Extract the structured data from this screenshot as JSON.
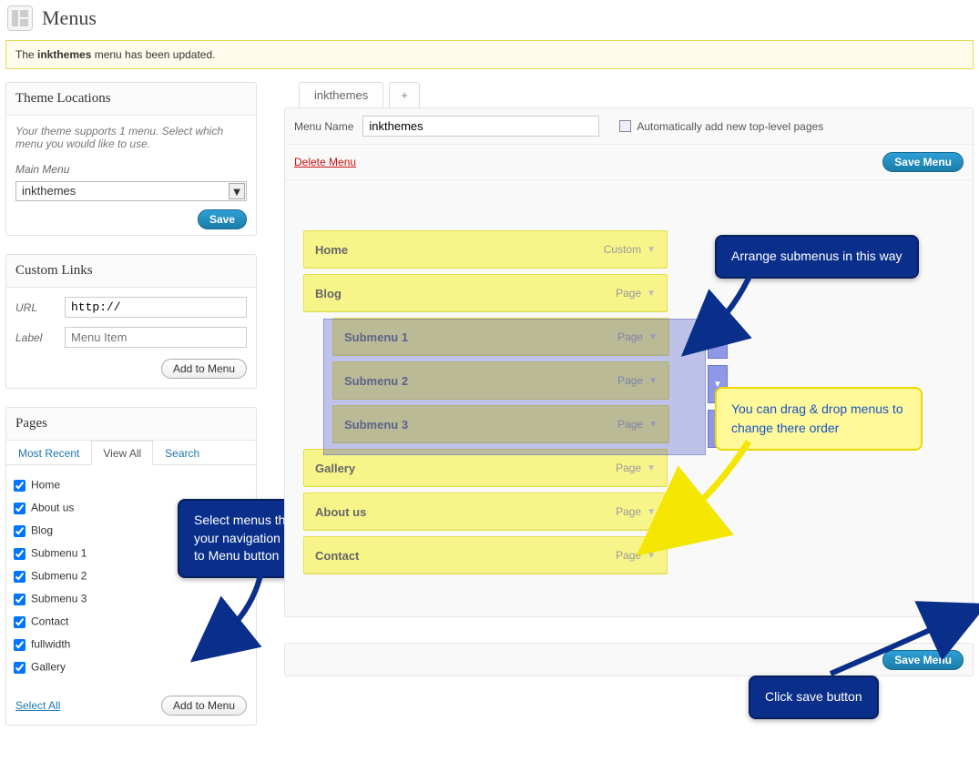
{
  "page": {
    "title": "Menus",
    "notice_prefix": "The ",
    "notice_strong": "inkthemes",
    "notice_suffix": " menu has been updated."
  },
  "sidebar": {
    "theme_locations": {
      "title": "Theme Locations",
      "desc": "Your theme supports 1 menu. Select which menu you would like to use.",
      "main_menu_label": "Main Menu",
      "select_value": "inkthemes",
      "save_label": "Save"
    },
    "custom_links": {
      "title": "Custom Links",
      "url_label": "URL",
      "url_value": "http://",
      "label_label": "Label",
      "label_placeholder": "Menu Item",
      "add_label": "Add to Menu"
    },
    "pages": {
      "title": "Pages",
      "tabs": [
        "Most Recent",
        "View All",
        "Search"
      ],
      "active_tab": "View All",
      "items": [
        {
          "label": "Home",
          "checked": true,
          "indent": 0
        },
        {
          "label": "About us",
          "checked": true,
          "indent": 0
        },
        {
          "label": "Blog",
          "checked": true,
          "indent": 0
        },
        {
          "label": "Submenu 1",
          "checked": true,
          "indent": 1
        },
        {
          "label": "Submenu 2",
          "checked": true,
          "indent": 1
        },
        {
          "label": "Submenu 3",
          "checked": true,
          "indent": 1
        },
        {
          "label": "Contact",
          "checked": true,
          "indent": 0
        },
        {
          "label": "fullwidth",
          "checked": true,
          "indent": 0
        },
        {
          "label": "Gallery",
          "checked": true,
          "indent": 0
        }
      ],
      "select_all": "Select All",
      "add_label": "Add to Menu"
    }
  },
  "menu": {
    "tab_name": "inkthemes",
    "plus": "+",
    "name_label": "Menu Name",
    "name_value": "inkthemes",
    "auto_add_label": "Automatically add new top-level pages",
    "delete_label": "Delete Menu",
    "save_label": "Save Menu",
    "items": [
      {
        "label": "Home",
        "type": "Custom",
        "sub": false
      },
      {
        "label": "Blog",
        "type": "Page",
        "sub": false
      },
      {
        "label": "Submenu 1",
        "type": "Page",
        "sub": true
      },
      {
        "label": "Submenu 2",
        "type": "Page",
        "sub": true
      },
      {
        "label": "Submenu 3",
        "type": "Page",
        "sub": true
      },
      {
        "label": "Gallery",
        "type": "Page",
        "sub": false
      },
      {
        "label": "About us",
        "type": "Page",
        "sub": false
      },
      {
        "label": "Contact",
        "type": "Page",
        "sub": false
      }
    ]
  },
  "callouts": {
    "c1": "Arrange submenus in this way",
    "c2": "You can drag & drop menus to change there order",
    "c3": "Select menus that you want at your navigation bar & click Add to Menu button",
    "c4": "Click save button"
  }
}
